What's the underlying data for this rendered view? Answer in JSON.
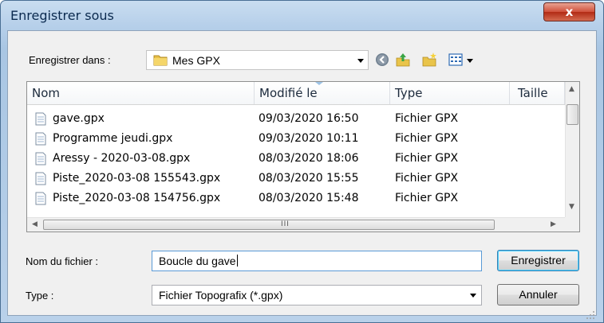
{
  "window": {
    "title": "Enregistrer sous",
    "close_glyph": "x"
  },
  "location": {
    "label": "Enregistrer dans :",
    "current_folder": "Mes GPX"
  },
  "toolbar": {
    "icons": [
      "back-icon",
      "up-folder-icon",
      "new-folder-icon",
      "view-menu-icon"
    ]
  },
  "file_list": {
    "columns": [
      "Nom",
      "Modifié le",
      "Type",
      "Taille"
    ],
    "rows": [
      {
        "name": "gave.gpx",
        "modified": "09/03/2020 16:50",
        "type": "Fichier GPX"
      },
      {
        "name": "Programme jeudi.gpx",
        "modified": "09/03/2020 10:11",
        "type": "Fichier GPX"
      },
      {
        "name": "Aressy - 2020-03-08.gpx",
        "modified": "08/03/2020 18:06",
        "type": "Fichier GPX"
      },
      {
        "name": "Piste_2020-03-08 155543.gpx",
        "modified": "08/03/2020 15:55",
        "type": "Fichier GPX"
      },
      {
        "name": "Piste_2020-03-08 154756.gpx",
        "modified": "08/03/2020 15:48",
        "type": "Fichier GPX"
      }
    ],
    "hscroll_grip": "III"
  },
  "filename": {
    "label": "Nom du fichier :",
    "value": "Boucle du gave"
  },
  "filetype": {
    "label": "Type :",
    "value": "Fichier Topografix (*.gpx)"
  },
  "buttons": {
    "save": "Enregistrer",
    "cancel": "Annuler"
  },
  "colors": {
    "title_bar": "#b7d0ea",
    "close_button": "#c7432d",
    "default_button_border": "#3c7fb1"
  }
}
